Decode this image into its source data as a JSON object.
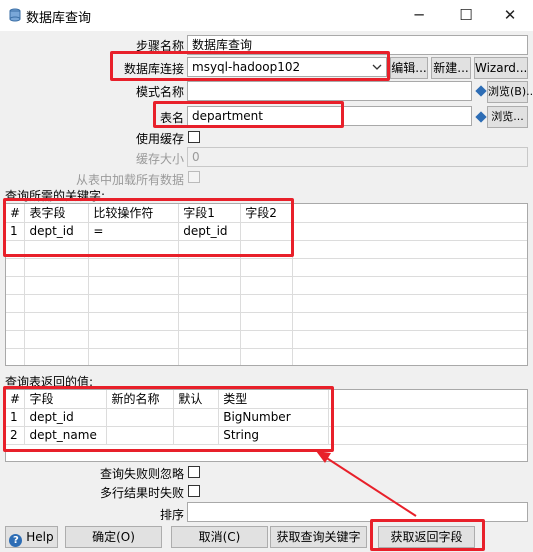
{
  "window": {
    "title": "数据库查询",
    "minimize_glyph": "─",
    "maximize_glyph": "☐",
    "close_glyph": "✕"
  },
  "form": {
    "step_name_label": "步骤名称",
    "step_name_value": "数据库查询",
    "db_conn_label": "数据库连接",
    "db_conn_value": "msyql-hadoop102",
    "edit_button": "编辑...",
    "new_button": "新建...",
    "wizard_button": "Wizard...",
    "schema_label": "模式名称",
    "schema_value": "",
    "browse_b_button": "浏览(B)...",
    "table_label": "表名",
    "table_value": "department",
    "browse_button": "浏览...",
    "use_cache_label": "使用缓存",
    "cache_size_label": "缓存大小",
    "cache_size_value": "0",
    "load_all_label": "从表中加载所有数据"
  },
  "keys_section": {
    "label": "查询所需的关键字:",
    "columns": [
      "#",
      "表字段",
      "比较操作符",
      "字段1",
      "字段2"
    ],
    "rows": [
      [
        "1",
        "dept_id",
        "=",
        "dept_id",
        ""
      ]
    ]
  },
  "return_section": {
    "label": "查询表返回的值:",
    "columns": [
      "#",
      "字段",
      "新的名称",
      "默认",
      "类型"
    ],
    "rows": [
      [
        "1",
        "dept_id",
        "",
        "",
        "BigNumber"
      ],
      [
        "2",
        "dept_name",
        "",
        "",
        "String"
      ]
    ]
  },
  "options": {
    "fail_ignore_label": "查询失败则忽略",
    "multi_fail_label": "多行结果时失败",
    "order_label": "排序",
    "order_value": ""
  },
  "buttons": {
    "help": "Help",
    "help_glyph": "?",
    "ok": "确定(O)",
    "cancel": "取消(C)",
    "get_keys": "获取查询关键字",
    "get_fields": "获取返回字段"
  },
  "colors": {
    "highlight": "#e8202a",
    "accent": "#2d6db5"
  }
}
